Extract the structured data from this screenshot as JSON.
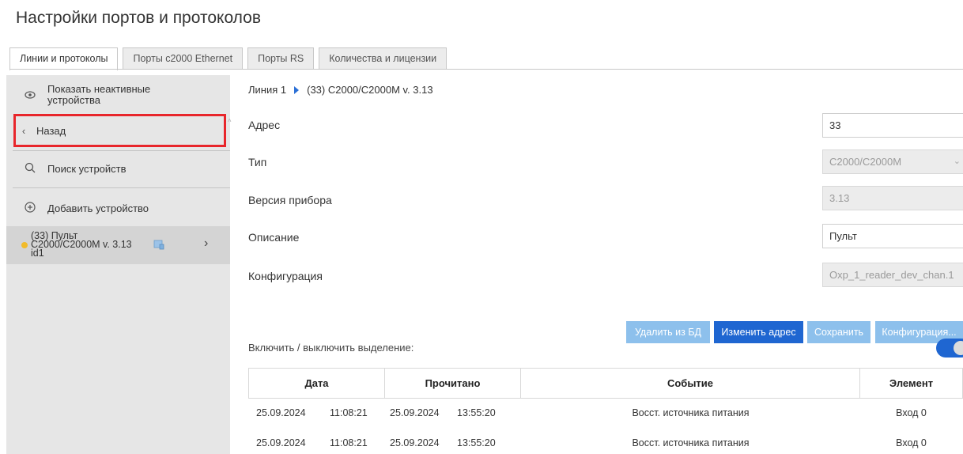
{
  "page": {
    "title": "Настройки портов и протоколов"
  },
  "tabs": [
    {
      "label": "Линии и протоколы",
      "active": true
    },
    {
      "label": "Порты с2000 Ethernet",
      "active": false
    },
    {
      "label": "Порты RS",
      "active": false
    },
    {
      "label": "Количества и лицензии",
      "active": false
    }
  ],
  "sidebar": {
    "show_inactive": {
      "icon": "eye-icon",
      "label": "Показать неактивные устройства"
    },
    "back": {
      "icon": "chevron-left-icon",
      "label": "Назад",
      "highlight_color": "#e8262b"
    },
    "search": {
      "icon": "search-icon",
      "label": "Поиск устройств"
    },
    "add": {
      "icon": "plus-circle-icon",
      "label": "Добавить устройство"
    },
    "device": {
      "line1": "(33) Пульт",
      "line2": "С2000/С2000М v. 3.13",
      "line3": "id1",
      "status_color": "#f1bb2a",
      "db_icon": "database-icon",
      "arrow_icon": "chevron-right-icon"
    }
  },
  "breadcrumb": {
    "line": "Линия 1",
    "device": "(33) С2000/С2000М v. 3.13"
  },
  "form": {
    "address": {
      "label": "Адрес",
      "value": "33"
    },
    "type": {
      "label": "Тип",
      "value": "С2000/С2000М"
    },
    "version": {
      "label": "Версия прибора",
      "value": "3.13"
    },
    "description": {
      "label": "Описание",
      "value": "Пульт"
    },
    "configuration": {
      "label": "Конфигурация",
      "value": "Oxp_1_reader_dev_chan.1"
    }
  },
  "buttons": {
    "delete": "Удалить из БД",
    "change_address": "Изменить адрес",
    "save": "Сохранить",
    "configuration": "Конфигурация..."
  },
  "highlight_toggle": {
    "label": "Включить / выключить выделение:",
    "on": true,
    "color": "#1f66d1"
  },
  "table": {
    "columns": [
      "Дата",
      "Прочитано",
      "Событие",
      "Элемент"
    ],
    "rows": [
      {
        "date": "25.09.2024",
        "time": "11:08:21",
        "read_date": "25.09.2024",
        "read_time": "13:55:20",
        "event": "Восст. источника питания",
        "element": "Вход 0"
      },
      {
        "date": "25.09.2024",
        "time": "11:08:21",
        "read_date": "25.09.2024",
        "read_time": "13:55:20",
        "event": "Восст. источника питания",
        "element": "Вход 0"
      }
    ]
  }
}
